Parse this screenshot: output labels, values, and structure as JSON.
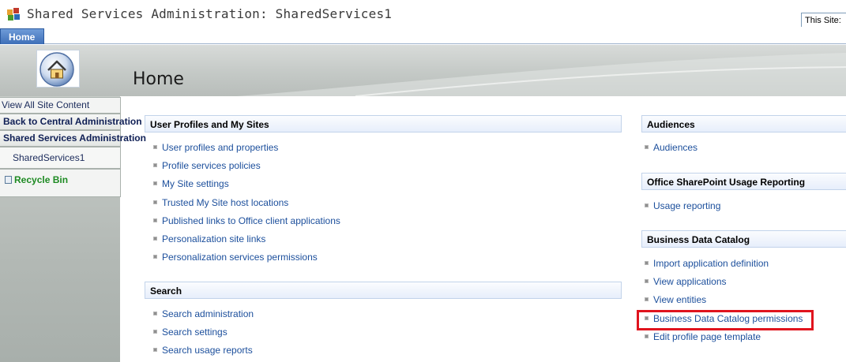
{
  "header": {
    "site_title": "Shared Services Administration: SharedServices1",
    "search_scope": "This Site:"
  },
  "tabs": [
    {
      "label": "Home",
      "selected": true
    }
  ],
  "page": {
    "title": "Home"
  },
  "leftnav": {
    "view_all": "View All Site Content",
    "back_central": "Back to Central Administration",
    "ssa": "Shared Services Administration",
    "ssp_name": "SharedServices1",
    "recycle_bin": "Recycle Bin"
  },
  "sections": {
    "user_profiles": {
      "title": "User Profiles and My Sites",
      "links": [
        "User profiles and properties",
        "Profile services policies",
        "My Site settings",
        "Trusted My Site host locations",
        "Published links to Office client applications",
        "Personalization site links",
        "Personalization services permissions"
      ]
    },
    "search": {
      "title": "Search",
      "links": [
        "Search administration",
        "Search settings",
        "Search usage reports"
      ]
    },
    "audiences": {
      "title": "Audiences",
      "links": [
        "Audiences"
      ]
    },
    "usage": {
      "title": "Office SharePoint Usage Reporting",
      "links": [
        "Usage reporting"
      ]
    },
    "bdc": {
      "title": "Business Data Catalog",
      "links": [
        "Import application definition",
        "View applications",
        "View entities",
        "Business Data Catalog permissions",
        "Edit profile page template"
      ]
    }
  },
  "colors": {
    "link": "#1c4f9c",
    "tab_selected": "#3e6fb8",
    "highlight": "#e0141e",
    "recycle": "#1d8a22"
  }
}
